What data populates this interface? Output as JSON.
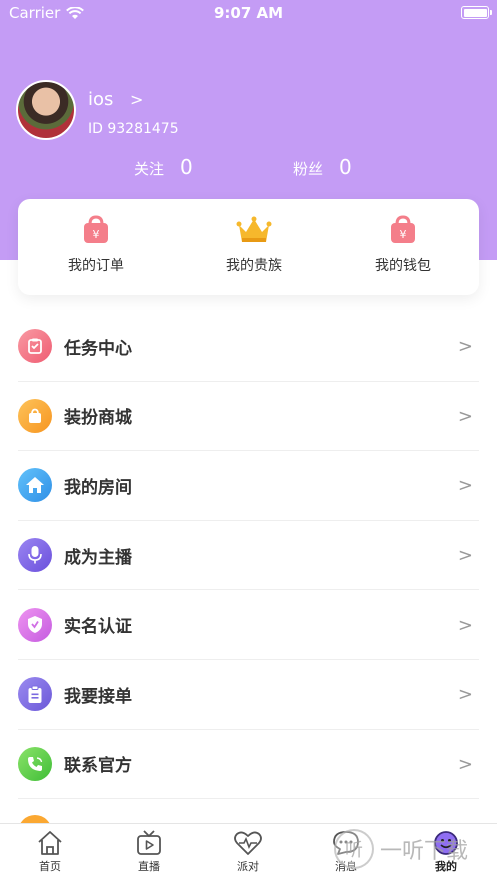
{
  "status_bar": {
    "carrier": "Carrier",
    "time": "9:07 AM"
  },
  "profile": {
    "name": "ios",
    "id_text": "ID 93281475"
  },
  "stats": {
    "follow_label": "关注",
    "follow_value": "0",
    "fans_label": "粉丝",
    "fans_value": "0"
  },
  "quick_actions": {
    "orders": "我的订单",
    "noble": "我的贵族",
    "wallet": "我的钱包"
  },
  "menu": [
    {
      "label": "任务中心",
      "icon": "task-center-icon",
      "color": "#f4727f"
    },
    {
      "label": "装扮商城",
      "icon": "dress-up-shop-icon",
      "color": "#fba832"
    },
    {
      "label": "我的房间",
      "icon": "home-icon",
      "color": "#43a7f0"
    },
    {
      "label": "成为主播",
      "icon": "microphone-icon",
      "color": "#7e64e6"
    },
    {
      "label": "实名认证",
      "icon": "verified-shield-icon",
      "color": "#d96de3"
    },
    {
      "label": "我要接单",
      "icon": "clipboard-icon",
      "color": "#7a6ae0"
    },
    {
      "label": "联系官方",
      "icon": "phone-icon",
      "color": "#5fd040"
    }
  ],
  "tabs": {
    "home": "首页",
    "live": "直播",
    "party": "派对",
    "messages": "消息",
    "mine": "我的"
  },
  "watermark": "一听下载",
  "colors": {
    "header": "#c49cf5",
    "divider": "#eeeeee"
  }
}
